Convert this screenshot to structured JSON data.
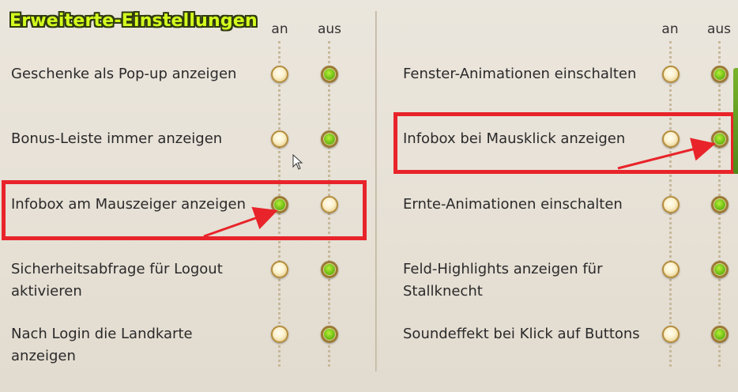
{
  "title": "Erweiterte-Einstellungen",
  "columns": {
    "on": "an",
    "off": "aus"
  },
  "left": [
    {
      "label": "Geschenke als Pop-up anzeigen",
      "value": "aus"
    },
    {
      "label": "Bonus-Leiste immer anzeigen",
      "value": "aus"
    },
    {
      "label": "Infobox am Mauszeiger anzeigen",
      "value": "an"
    },
    {
      "label": "Sicherheitsabfrage für Logout aktivieren",
      "value": "aus"
    },
    {
      "label": "Nach Login die Landkarte anzeigen",
      "value": "aus"
    }
  ],
  "right": [
    {
      "label": "Fenster-Animationen einschalten",
      "value": "aus"
    },
    {
      "label": "Infobox bei Mausklick anzeigen",
      "value": "aus"
    },
    {
      "label": "Ernte-Animationen einschalten",
      "value": "aus"
    },
    {
      "label": "Feld-Highlights anzeigen für Stallknecht",
      "value": "aus"
    },
    {
      "label": "Soundeffekt bei Klick auf Buttons",
      "value": "aus"
    }
  ],
  "colors": {
    "highlight": "#e8242a",
    "active": "#78c41a",
    "inactive": "#fbf1cc"
  }
}
